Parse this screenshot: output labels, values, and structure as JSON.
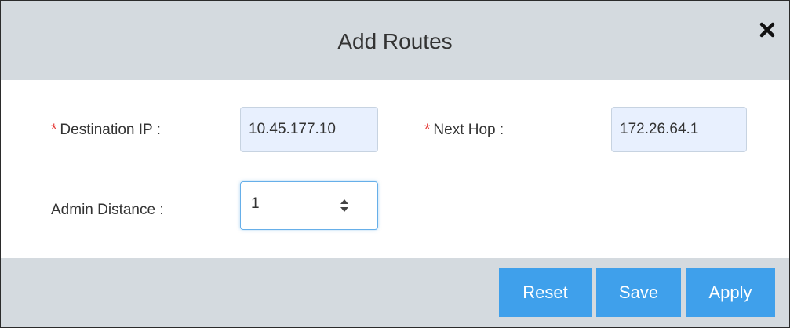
{
  "dialog": {
    "title": "Add Routes",
    "close_icon": "close-icon"
  },
  "form": {
    "required_mark": "*",
    "destination_ip": {
      "label": "Destination IP :",
      "value": "10.45.177.10"
    },
    "next_hop": {
      "label": "Next Hop :",
      "value": "172.26.64.1"
    },
    "admin_distance": {
      "label": "Admin Distance :",
      "value": "1",
      "stepper_icon": "sort-arrows-icon"
    }
  },
  "footer": {
    "reset_label": "Reset",
    "save_label": "Save",
    "apply_label": "Apply"
  },
  "colors": {
    "header_bg": "#d4dadf",
    "button_bg": "#3fa0eb",
    "required": "#e53935",
    "input_bg": "#e8f0fe"
  }
}
